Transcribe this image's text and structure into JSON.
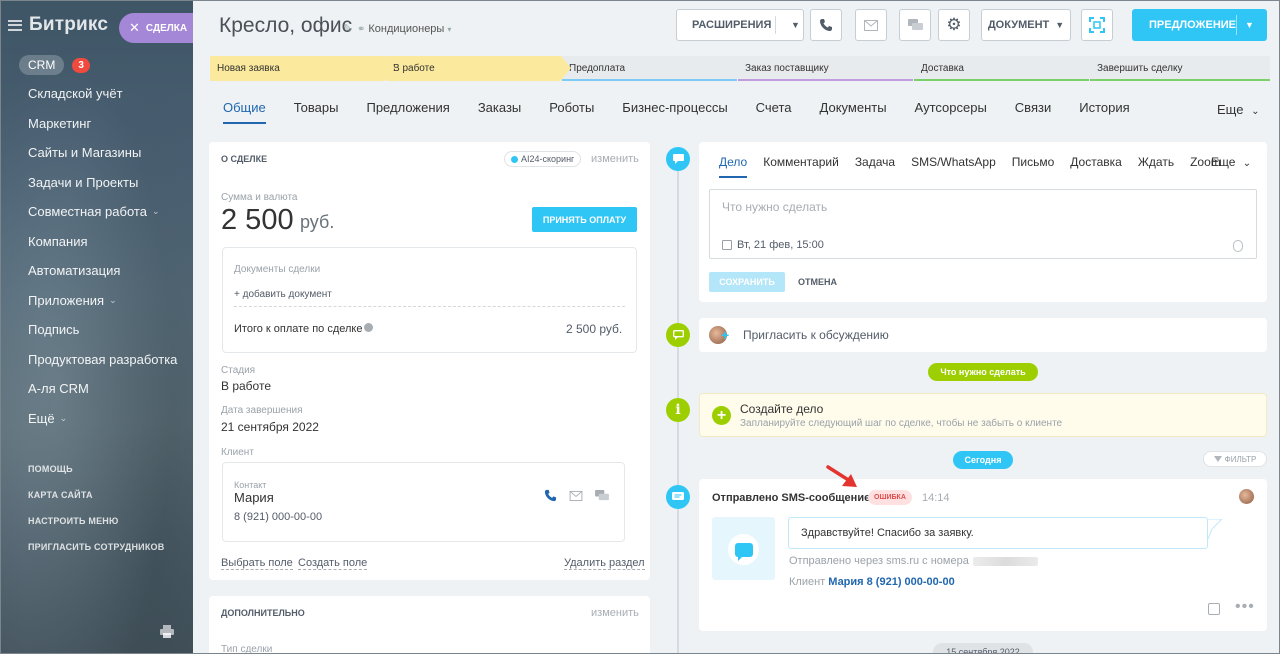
{
  "sidebar": {
    "logo": "Битрикс",
    "crm_label": "CRM",
    "crm_count": "3",
    "items": [
      {
        "label": "Складской учёт",
        "chev": false
      },
      {
        "label": "Маркетинг",
        "chev": false
      },
      {
        "label": "Сайты и Магазины",
        "chev": false
      },
      {
        "label": "Задачи и Проекты",
        "chev": false
      },
      {
        "label": "Совместная работа",
        "chev": true
      },
      {
        "label": "Компания",
        "chev": false
      },
      {
        "label": "Автоматизация",
        "chev": false
      },
      {
        "label": "Приложения",
        "chev": true
      },
      {
        "label": "Подпись",
        "chev": false
      },
      {
        "label": "Продуктовая разработка",
        "chev": false
      },
      {
        "label": "А-ля CRM",
        "chev": false
      },
      {
        "label": "Ещё",
        "chev": true
      }
    ],
    "small_links": [
      "ПОМОЩЬ",
      "КАРТА САЙТА",
      "НАСТРОИТЬ МЕНЮ",
      "ПРИГЛАСИТЬ СОТРУДНИКОВ"
    ]
  },
  "create_deal": {
    "label": "СДЕЛКА"
  },
  "header": {
    "title": "Кресло, офис",
    "category": "Кондиционеры",
    "extensions_label": "РАСШИРЕНИЯ",
    "document_label": "ДОКУМЕНТ",
    "offer_label": "ПРЕДЛОЖЕНИЕ"
  },
  "stages": [
    {
      "label": "Новая заявка",
      "bg": "#fbe99d",
      "line": "#fbe99d"
    },
    {
      "label": "В работе",
      "bg": "#fbe99d",
      "line": "#fbe99d"
    },
    {
      "label": "Предоплата",
      "bg": "#e8ebed",
      "line": "#7ccbf4"
    },
    {
      "label": "Заказ поставщику",
      "bg": "#e8ebed",
      "line": "#c39ce0"
    },
    {
      "label": "Доставка",
      "bg": "#e8ebed",
      "line": "#7cd06a"
    },
    {
      "label": "Завершить сделку",
      "bg": "#e8ebed",
      "line": "#7cd06a"
    }
  ],
  "tabs": [
    "Общие",
    "Товары",
    "Предложения",
    "Заказы",
    "Роботы",
    "Бизнес-процессы",
    "Счета",
    "Документы",
    "Аутсорсеры",
    "Связи",
    "История"
  ],
  "tabs_more": "Еще",
  "about": {
    "title": "О СДЕЛКЕ",
    "scoring": "AI24-скоринг",
    "change": "изменить",
    "sum_label": "Сумма и валюта",
    "sum_value": "2 500",
    "sum_currency": "руб.",
    "pay_button": "ПРИНЯТЬ ОПЛАТУ",
    "docs_label": "Документы сделки",
    "add_doc": "+ добавить документ",
    "total_label": "Итого к оплате по сделке",
    "total_value": "2 500",
    "total_currency": "руб.",
    "stage_label": "Стадия",
    "stage_value": "В работе",
    "close_label": "Дата завершения",
    "close_value": "21 сентября 2022",
    "client_label": "Клиент",
    "contact_label": "Контакт",
    "contact_name": "Мария",
    "contact_phone": "8 (921) 000-00-00",
    "select_field": "Выбрать поле",
    "create_field": "Создать поле",
    "delete_section": "Удалить раздел"
  },
  "extra": {
    "title": "ДОПОЛНИТЕЛЬНО",
    "change": "изменить",
    "deal_type_label": "Тип сделки"
  },
  "activity": {
    "tabs": [
      "Дело",
      "Комментарий",
      "Задача",
      "SMS/WhatsApp",
      "Письмо",
      "Доставка",
      "Ждать",
      "Zoom"
    ],
    "more": "Еще",
    "placeholder": "Что нужно сделать",
    "date": "Вт, 21 фев, 15:00",
    "save": "СОХРАНИТЬ",
    "cancel": "ОТМЕНА"
  },
  "invite": "Пригласить к обсуждению",
  "todo_pill": "Что нужно сделать",
  "create_task": {
    "title": "Создайте дело",
    "subtitle": "Запланируйте следующий шаг по сделке, чтобы не забыть о клиенте"
  },
  "today_pill": "Сегодня",
  "filter": "ФИЛЬТР",
  "sms": {
    "title": "Отправлено SMS-сообщение",
    "badge": "ОШИБКА",
    "time": "14:14",
    "message": "Здравствуйте! Спасибо за заявку.",
    "via": "Отправлено через sms.ru с номера",
    "client_label": "Клиент",
    "client_value": "Мария 8 (921) 000-00-00"
  },
  "date_pill": "15 сентября 2022",
  "colors": {
    "accent": "#2fc6f6",
    "link": "#2067b0",
    "green": "#9dcf00",
    "error": "#e24c4c"
  }
}
